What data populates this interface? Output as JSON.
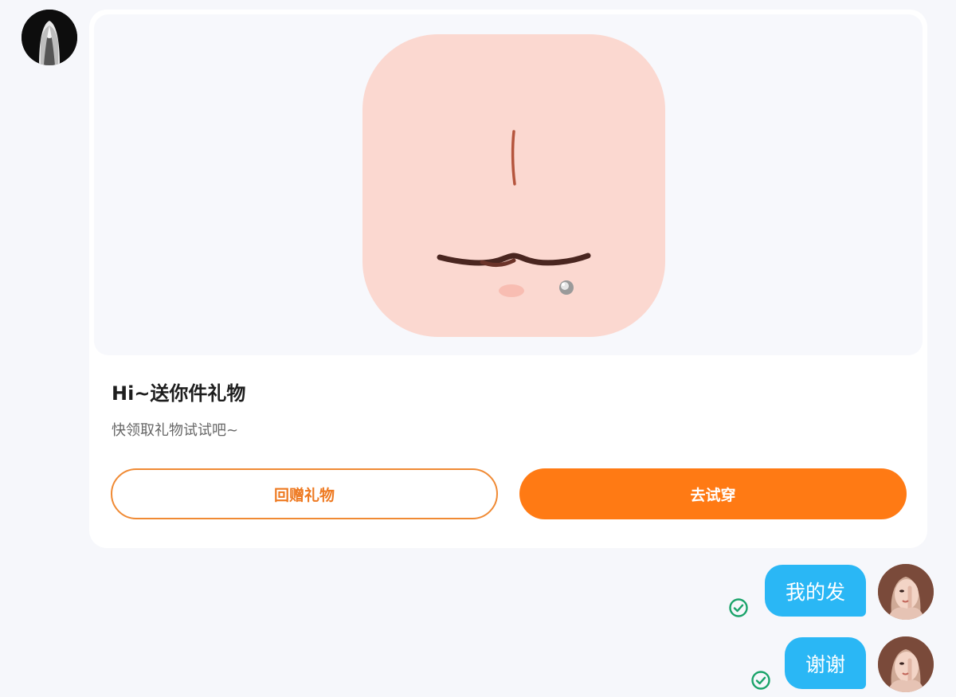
{
  "gift_card": {
    "title": "Hi~送你件礼物",
    "subtitle": "快领取礼物试试吧~",
    "return_gift_label": "回赠礼物",
    "try_on_label": "去试穿"
  },
  "messages": [
    {
      "text": "我的发",
      "status": "check-circle-icon"
    },
    {
      "text": "谢谢",
      "status": "check-circle-icon"
    }
  ],
  "colors": {
    "accent_orange": "#ff7a14",
    "bubble_blue": "#2ab7f5",
    "check_green": "#1aa36a"
  }
}
